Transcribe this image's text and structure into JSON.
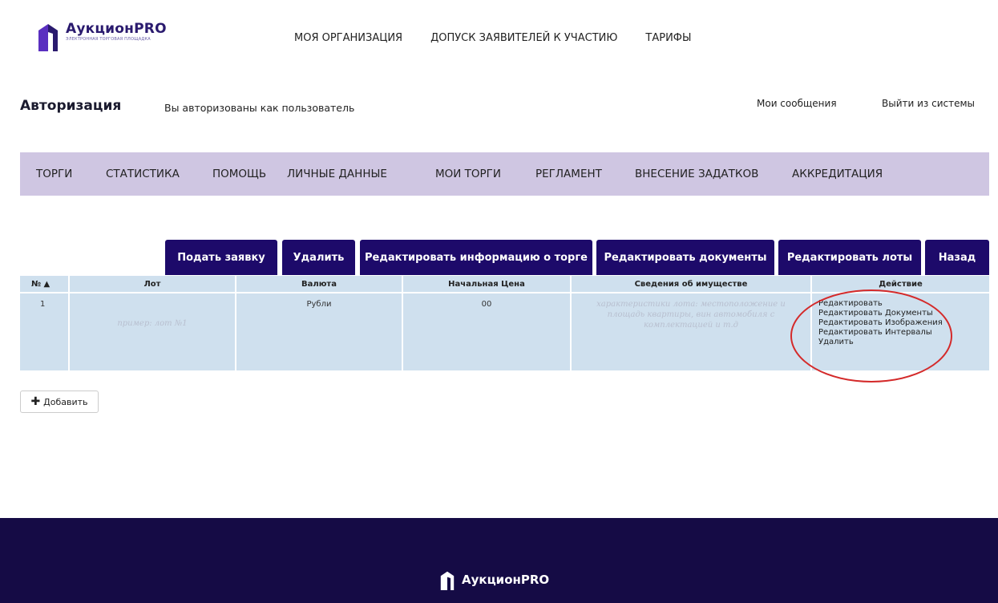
{
  "header": {
    "logo_title": "АукционPRO",
    "logo_subtitle": "ЭЛЕКТРОННАЯ ТОРГОВАЯ ПЛОЩАДКА",
    "nav": [
      "МОЯ ОРГАНИЗАЦИЯ",
      "ДОПУСК ЗАЯВИТЕЛЕЙ К УЧАСТИЮ",
      "ТАРИФЫ"
    ]
  },
  "auth": {
    "title": "Авторизация",
    "status": "Вы авторизованы как пользователь",
    "messages": "Мои сообщения",
    "logout": "Выйти из системы"
  },
  "menu": [
    "ТОРГИ",
    "СТАТИСТИКА",
    "ПОМОЩЬ",
    "ЛИЧНЫЕ ДАННЫЕ",
    "МОИ ТОРГИ",
    "РЕГЛАМЕНТ",
    "ВНЕСЕНИЕ ЗАДАТКОВ",
    "АККРЕДИТАЦИЯ"
  ],
  "buttons": {
    "apply": "Подать заявку",
    "delete": "Удалить",
    "edit_info": "Редактировать информацию о торге",
    "edit_docs": "Редактировать документы",
    "edit_lots": "Редактировать лоты",
    "back": "Назад"
  },
  "table": {
    "headers": [
      "№ ▲",
      "Лот",
      "Валюта",
      "Начальная Цена",
      "Сведения об имуществе",
      "Действие"
    ],
    "rows": [
      {
        "num": "1",
        "lot_placeholder": "пример: лот №1",
        "currency": "Рубли",
        "price": "00",
        "property_placeholder": "характеристики лота: местоположение и площадь квартиры, вин автомобиля с комплектацией и т.д",
        "actions": [
          "Редактировать",
          "Редактировать Документы",
          "Редактировать Изображения",
          "Редактировать Интервалы",
          "Удалить"
        ]
      }
    ]
  },
  "add_button": "Добавить",
  "footer": {
    "logo_title": "АукционPRO"
  },
  "colors": {
    "brand": "#1d0a6a",
    "menu_bg": "#cfc6e2",
    "table_bg": "#cfe0ee",
    "footer_bg": "#150b45",
    "annotation": "#d42a2a"
  }
}
